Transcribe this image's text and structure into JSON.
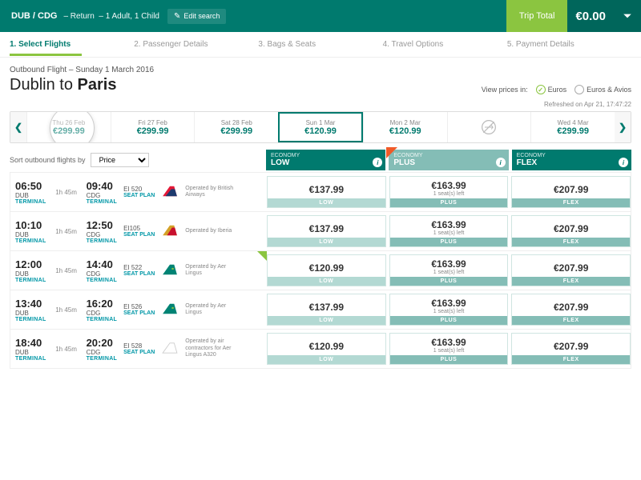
{
  "topbar": {
    "route": "DUB / CDG",
    "trip_type": "Return",
    "pax": "1 Adult, 1 Child",
    "edit_label": "Edit search",
    "trip_total_label": "Trip Total",
    "trip_total_price": "€0.00"
  },
  "steps": [
    "1. Select Flights",
    "2. Passenger Details",
    "3. Bags & Seats",
    "4. Travel Options",
    "5. Payment Details"
  ],
  "heading": {
    "outbound_label": "Outbound Flight – Sunday 1 March 2016",
    "from_city": "Dublin",
    "to_word": "to",
    "to_city": "Paris",
    "view_prices_label": "View prices in:",
    "radio_euros": "Euros",
    "radio_avios": "Euros & Avios",
    "refreshed": "Refreshed on Apr 21, 17:47:22"
  },
  "dates": [
    {
      "label": "Thu 26 Feb",
      "price": "€299.99"
    },
    {
      "label": "Fri 27 Feb",
      "price": "€299.99"
    },
    {
      "label": "Sat 28 Feb",
      "price": "€299.99"
    },
    {
      "label": "Sun 1 Mar",
      "price": "€120.99",
      "selected": true
    },
    {
      "label": "Mon 2 Mar",
      "price": "€120.99"
    },
    {
      "label": "",
      "price": "",
      "no_flight": true
    },
    {
      "label": "Wed 4 Mar",
      "price": "€299.99"
    }
  ],
  "sort": {
    "label": "Sort outbound flights by",
    "value": "Price"
  },
  "fare_headers": {
    "economy": "ECONOMY",
    "low": "LOW",
    "plus": "PLUS",
    "flex": "FLEX"
  },
  "flights": [
    {
      "dep_time": "06:50",
      "dep_code": "DUB",
      "duration": "1h 45m",
      "arr_time": "09:40",
      "arr_code": "CDG",
      "fno": "EI 520",
      "operated": "Operated by British Airways",
      "tail": "ba",
      "low": "€137.99",
      "plus": "€163.99",
      "plus_seats": "1 seat(s) left",
      "flex": "€207.99"
    },
    {
      "dep_time": "10:10",
      "dep_code": "DUB",
      "duration": "1h 45m",
      "arr_time": "12:50",
      "arr_code": "CDG",
      "fno": "EI105",
      "operated": "Operated by Iberia",
      "tail": "iberia",
      "low": "€137.99",
      "plus": "€163.99",
      "plus_seats": "1 seat(s) left",
      "flex": "€207.99"
    },
    {
      "dep_time": "12:00",
      "dep_code": "DUB",
      "duration": "1h 45m",
      "arr_time": "14:40",
      "arr_code": "CDG",
      "fno": "EI 522",
      "operated": "Operated by Aer Lingus",
      "tail": "aerlingus",
      "sash": true,
      "low": "€120.99",
      "plus": "€163.99",
      "plus_seats": "1 seat(s) left",
      "flex": "€207.99"
    },
    {
      "dep_time": "13:40",
      "dep_code": "DUB",
      "duration": "1h 45m",
      "arr_time": "16:20",
      "arr_code": "CDG",
      "fno": "EI 526",
      "operated": "Operated by Aer Lingus",
      "tail": "aerlingus",
      "low": "€137.99",
      "plus": "€163.99",
      "plus_seats": "1 seat(s) left",
      "flex": "€207.99"
    },
    {
      "dep_time": "18:40",
      "dep_code": "DUB",
      "duration": "1h 45m",
      "arr_time": "20:20",
      "arr_code": "CDG",
      "fno": "EI 528",
      "operated": "Operated by air contractors for Aer Lingus A320",
      "tail": "generic",
      "low": "€120.99",
      "plus": "€163.99",
      "plus_seats": "1 seat(s) left",
      "flex": "€207.99"
    }
  ],
  "labels": {
    "terminal": "TERMINAL",
    "seatplan": "SEAT PLAN",
    "low": "LOW",
    "plus": "PLUS",
    "flex": "FLEX"
  }
}
